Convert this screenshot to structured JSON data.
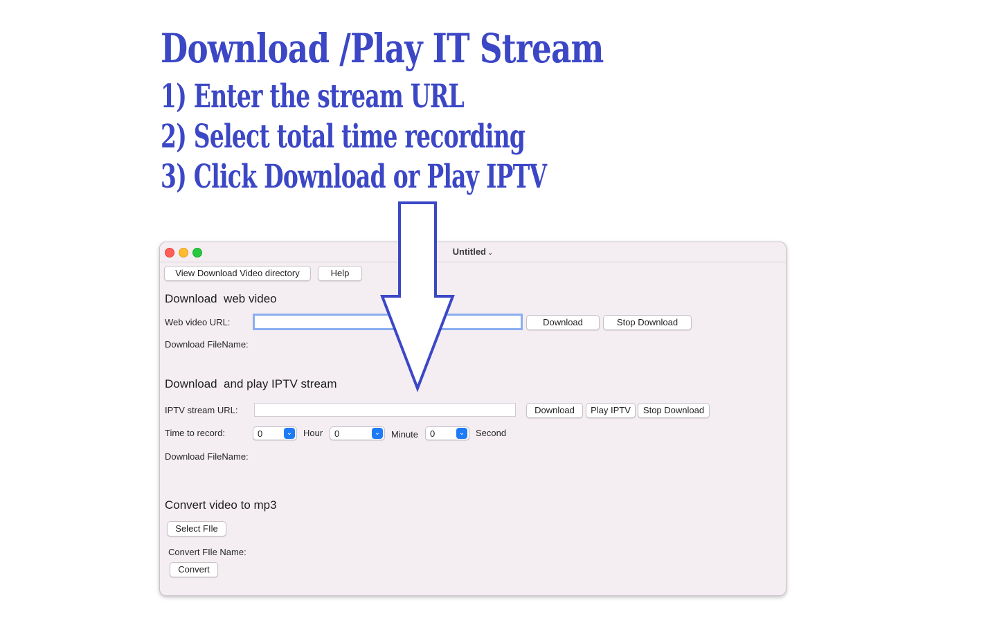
{
  "headline": {
    "title": "Download /Play IT Stream",
    "steps": [
      "1) Enter the stream URL",
      "2) Select total time recording",
      "3) Click Download or Play IPTV"
    ]
  },
  "colors": {
    "headline": "#3c47c6",
    "arrow_stroke": "#3c47c6",
    "window_bg": "#f4eef3",
    "select_accent": "#1e7bf5",
    "focus_ring": "#8aaef0"
  },
  "window": {
    "title": "Untitled",
    "toolbar": {
      "view_dir_label": "View Download Video directory",
      "help_label": "Help"
    },
    "web_video": {
      "heading": "Download  web video",
      "url_label": "Web video URL:",
      "url_value": "",
      "download_label": "Download",
      "stop_label": "Stop Download",
      "filename_label": "Download FileName:"
    },
    "iptv": {
      "heading": "Download  and play IPTV stream",
      "url_label": "IPTV stream URL:",
      "url_value": "",
      "download_label": "Download",
      "play_label": "Play IPTV",
      "stop_label": "Stop Download",
      "time_label": "Time to record:",
      "hour_value": "0",
      "hour_label": "Hour",
      "minute_value": "0",
      "minute_label": "Minute",
      "second_value": "0",
      "second_label": "Second",
      "filename_label": "Download FileName:"
    },
    "convert": {
      "heading": "Convert video to mp3",
      "select_label": "Select FIle",
      "name_label": "Convert FIle Name:",
      "convert_label": "Convert"
    }
  }
}
